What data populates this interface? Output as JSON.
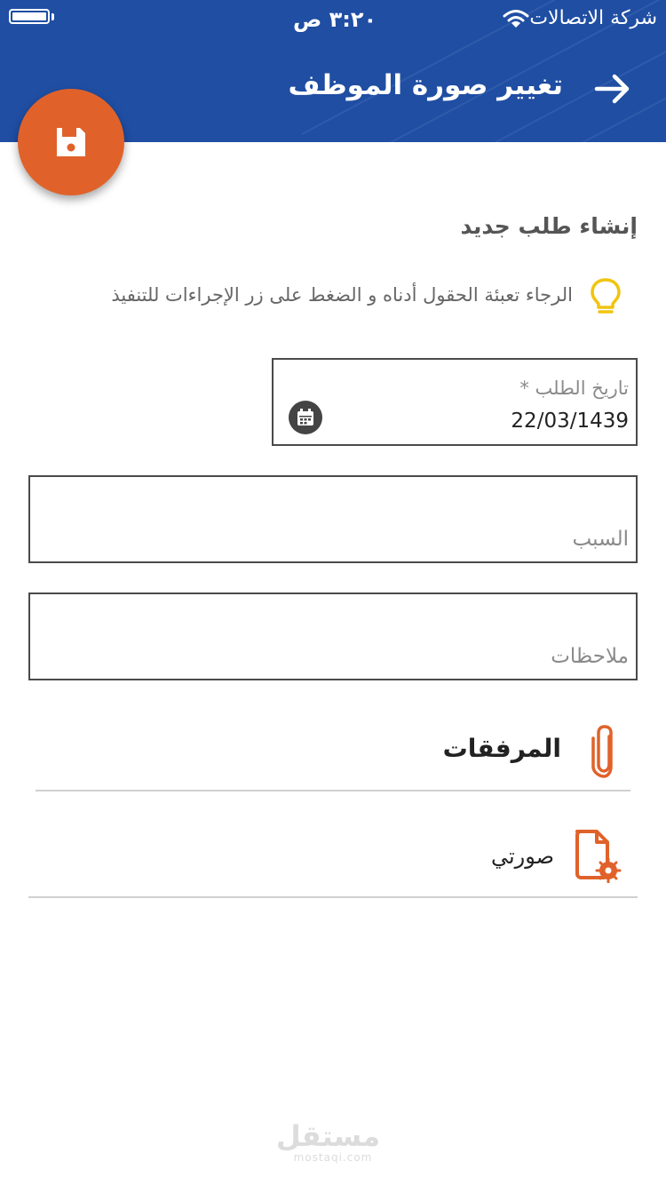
{
  "status_bar": {
    "time": "٣:٢٠ ص",
    "carrier": "شركة الاتصالات"
  },
  "header": {
    "title": "تغيير صورة الموظف",
    "back_icon": "arrow-right-icon",
    "background_color": "#1f4ea3"
  },
  "fab": {
    "icon": "save-icon",
    "color": "#e0622a"
  },
  "form": {
    "section_title": "إنشاء طلب جديد",
    "hint_icon": "lightbulb-icon",
    "hint_text": "الرجاء تعبئة الحقول أدناه و الضغط على زر الإجراءات للتنفيذ",
    "date_field": {
      "label": "تاريخ الطلب *",
      "value": "22/03/1439",
      "icon": "calendar-icon"
    },
    "reason_field": {
      "placeholder": "السبب",
      "value": ""
    },
    "notes_field": {
      "placeholder": "ملاحظات",
      "value": ""
    }
  },
  "attachments": {
    "title": "المرفقات",
    "icon": "paperclip-icon",
    "accent_color": "#e0622a",
    "items": [
      {
        "label": "صورتي",
        "icon": "file-settings-icon"
      }
    ]
  },
  "watermark": {
    "arabic": "مستقل",
    "latin": "mostaqi.com"
  }
}
